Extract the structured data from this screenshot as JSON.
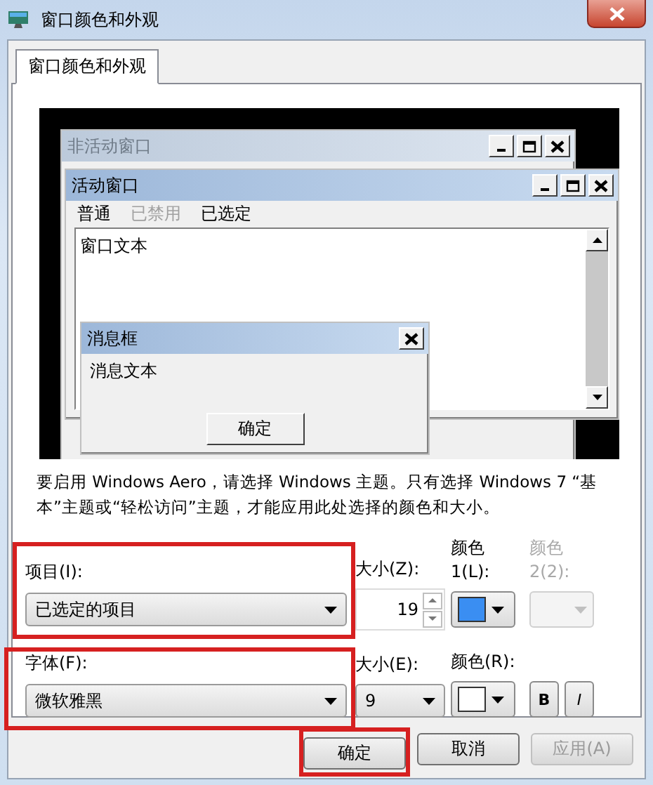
{
  "window": {
    "title": "窗口颜色和外观"
  },
  "tabs": [
    {
      "label": "窗口颜色和外观",
      "selected": true
    }
  ],
  "preview": {
    "inactive_window": {
      "title": "非活动窗口"
    },
    "active_window": {
      "title": "活动窗口",
      "menu": [
        {
          "label": "普通",
          "disabled": false
        },
        {
          "label": "已禁用",
          "disabled": true
        },
        {
          "label": "已选定",
          "disabled": false
        }
      ],
      "text": "窗口文本"
    },
    "message_box": {
      "title": "消息框",
      "text": "消息文本",
      "button": "确定"
    }
  },
  "note": "要启用 Windows Aero，请选择 Windows 主题。只有选择 Windows 7 “基本”主题或“轻松访问”主题，才能应用此处选择的颜色和大小。",
  "item": {
    "label": "项目(I):",
    "value": "已选定的项目",
    "highlighted": true
  },
  "item_size": {
    "label": "大小(Z):",
    "value": "19"
  },
  "color_1": {
    "label": "颜色 1(L):",
    "color": "#3a8ef2",
    "disabled": false
  },
  "color_2": {
    "label": "颜色 2(2):",
    "disabled": true
  },
  "font": {
    "label": "字体(F):",
    "value": "微软雅黑",
    "highlighted": true
  },
  "font_size": {
    "label": "大小(E):",
    "value": "9"
  },
  "font_color": {
    "label": "颜色(R):",
    "color": "#ffffff"
  },
  "style_buttons": [
    {
      "label": "B",
      "kind": "bold"
    },
    {
      "label": "I",
      "kind": "italic"
    }
  ],
  "buttons": [
    {
      "label": "确定",
      "highlighted": true,
      "disabled": false
    },
    {
      "label": "取消",
      "highlighted": false,
      "disabled": false
    },
    {
      "label": "应用(A)",
      "highlighted": false,
      "disabled": true
    }
  ]
}
